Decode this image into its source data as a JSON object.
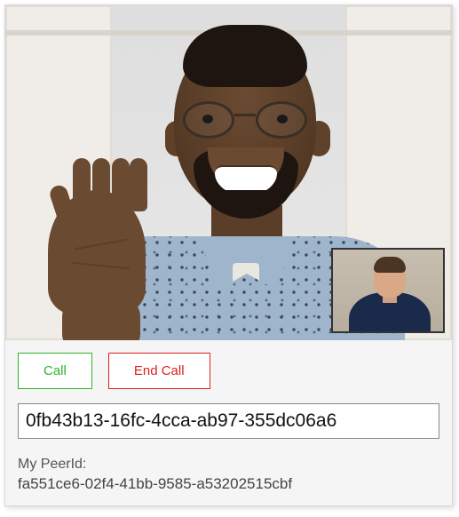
{
  "controls": {
    "call_label": "Call",
    "end_call_label": "End Call"
  },
  "peer_input": {
    "value": "0fb43b13-16fc-4cca-ab97-355dc06a6"
  },
  "peer_info": {
    "label": "My PeerId:",
    "value": "fa551ce6-02f4-41bb-9585-a53202515cbf"
  }
}
